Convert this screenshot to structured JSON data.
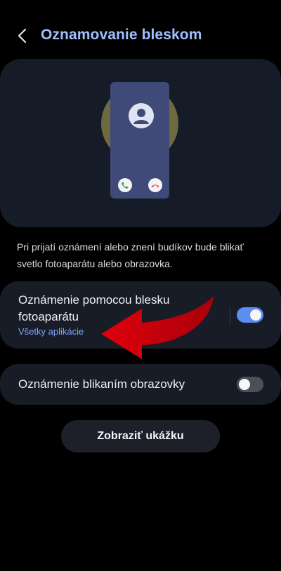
{
  "header": {
    "title": "Oznamovanie bleskom",
    "back_icon": "chevron-left-icon"
  },
  "illustration": {
    "phone_color": "#3f4a78",
    "glow_color": "#6e6a3f",
    "icons": [
      "person-icon",
      "phone-accept-icon",
      "phone-decline-icon"
    ]
  },
  "description": "Pri prijatí oznámení alebo znení budíkov bude blikať svetlo fotoaparátu alebo obrazovka.",
  "settings": [
    {
      "title": "Oznámenie pomocou blesku fotoaparátu",
      "subtitle": "Všetky aplikácie",
      "enabled": true
    },
    {
      "title": "Oznámenie blikaním obrazovky",
      "enabled": false
    }
  ],
  "preview_button": "Zobraziť ukážku",
  "colors": {
    "accent": "#9fbfff",
    "link": "#7fa7ff",
    "toggle_on": "#5a8ef0",
    "annotation_arrow": "#e0000b"
  }
}
